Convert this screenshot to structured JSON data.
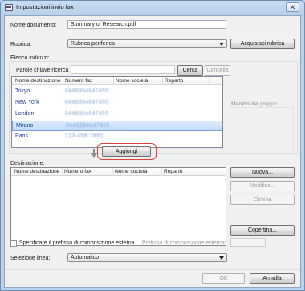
{
  "window": {
    "title": "Impostazioni invio fax"
  },
  "document": {
    "label": "Nome documento:",
    "value": "Summary of Research.pdf"
  },
  "rubrica": {
    "label": "Rubrica:",
    "selected": "Rubrica periferica",
    "acquire_button": "Acquisisci rubrica"
  },
  "address_list": {
    "label": "Elenco indirizzi:",
    "search_label": "Parole chiave ricerca",
    "search_value": "",
    "search_button": "Cerca",
    "cancel_button": "Cancella",
    "columns": [
      "Nome destinazione",
      "Numero fax",
      "Nome società",
      "Reparto"
    ],
    "rows": [
      {
        "name": "Tokyo",
        "fax": "0446354647455",
        "company": "",
        "dept": ""
      },
      {
        "name": "New York",
        "fax": "0446354647455",
        "company": "",
        "dept": ""
      },
      {
        "name": "London",
        "fax": "0446354647455",
        "company": "",
        "dept": ""
      },
      {
        "name": "Mirano",
        "fax": "0446354647455",
        "company": "",
        "dept": ""
      },
      {
        "name": "Paris",
        "fax": "123-456-7890",
        "company": "",
        "dept": ""
      }
    ],
    "selected_index": 3
  },
  "group_members_label": "Membri del gruppo:",
  "add_button": "Aggiungi",
  "destination": {
    "label": "Destinazione:",
    "columns": [
      "Nome destinazione",
      "Numero fax",
      "Nome società",
      "Reparto"
    ],
    "new_button": "Nuova...",
    "edit_button": "Modifica...",
    "delete_button": "Elimina",
    "cover_button": "Copertina..."
  },
  "prefix": {
    "checkbox_label": "Specificare il prefisso di composizione esterna",
    "field_label": "Prefisso di composizione esterna:",
    "value": ""
  },
  "line": {
    "label": "Selezione linea:",
    "selected": "Automatico"
  },
  "footer": {
    "ok_button": "OK",
    "cancel_button": "Annulla"
  },
  "colors": {
    "accent": "#3c7fb1",
    "selection": "#c1dbfc",
    "highlight": "#e04040"
  }
}
